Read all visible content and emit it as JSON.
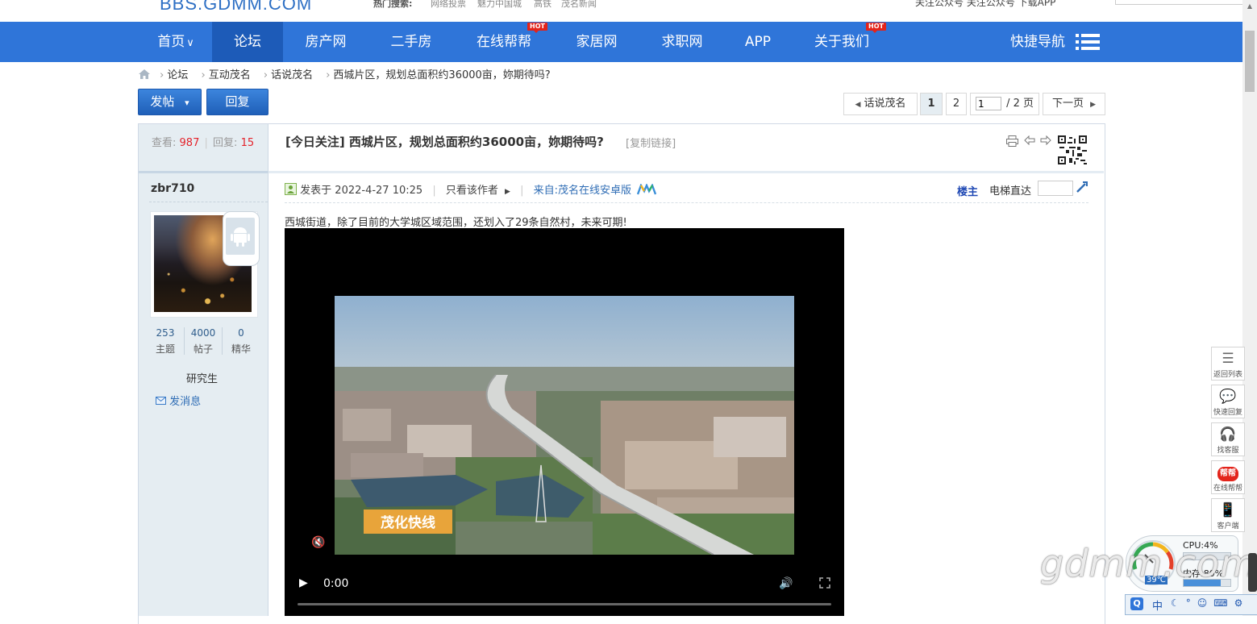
{
  "topbar": {
    "site_logo": "BBS.GDMM.COM",
    "hot_search_label": "热门搜索:",
    "hot_links": [
      "网络投票",
      "魅力中国城",
      "高铁",
      "茂名新闻"
    ],
    "right_text": "关注公众号  关注公众号  下载APP"
  },
  "nav": {
    "items": [
      {
        "label": "首页",
        "has_caret": true
      },
      {
        "label": "论坛",
        "active": true
      },
      {
        "label": "房产网"
      },
      {
        "label": "二手房"
      },
      {
        "label": "在线帮帮",
        "badge": "HOT"
      },
      {
        "label": "家居网"
      },
      {
        "label": "求职网"
      },
      {
        "label": "APP"
      },
      {
        "label": "关于我们",
        "badge": "HOT"
      }
    ],
    "quick_nav_label": "快捷导航",
    "home_caret": "∨"
  },
  "breadcrumb": [
    "论坛",
    "互动茂名",
    "话说茂名",
    "西城片区，规划总面积约36000亩，妳期待吗?"
  ],
  "actions": {
    "post_label": "发帖",
    "post_caret": "▾",
    "reply_label": "回复"
  },
  "pagination": {
    "back_label": "话说茂名",
    "pages": [
      "1",
      "2"
    ],
    "current_page_value": "1",
    "total_label": "/ 2 页",
    "next_label": "下一页"
  },
  "thread": {
    "views_label": "查看:",
    "views": "987",
    "divider": "|",
    "replies_label": "回复:",
    "replies": "15",
    "title": "[今日关注] 西城片区，规划总面积约36000亩，妳期待吗?",
    "copy_link_label": "[复制链接]"
  },
  "author": {
    "name": "zbr710",
    "stats": [
      {
        "value": "253",
        "label": "主题"
      },
      {
        "value": "4000",
        "label": "帖子"
      },
      {
        "value": "0",
        "label": "精华"
      }
    ],
    "rank": "研究生",
    "message_label": "发消息"
  },
  "post": {
    "posted_prefix": "发表于",
    "posted_time": "2022-4-27 10:25",
    "only_author_label": "只看该作者",
    "source_label": "来自:茂名在线安卓版",
    "floor_label": "楼主",
    "elevator_label": "电梯直达",
    "content": "西城街道，除了目前的大学城区域范围，还划入了29条自然村，未来可期!"
  },
  "video": {
    "caption": "茂化快线",
    "time": "0:00",
    "progress": 0
  },
  "float_tools": [
    {
      "icon": "list-icon",
      "label": "返回列表"
    },
    {
      "icon": "chat-icon",
      "label": "快速回复"
    },
    {
      "icon": "headset-icon",
      "label": "找客服"
    },
    {
      "icon": "bangbang-icon",
      "label": "在线帮帮",
      "glyph": "帮帮"
    },
    {
      "icon": "app-icon",
      "label": "客户端"
    }
  ],
  "watermark": "gdmm.com",
  "system_widget": {
    "cpu": "CPU:4%",
    "memory": "内存:80%",
    "temperature": "39℃"
  },
  "ime": {
    "text": "中"
  },
  "colors": {
    "nav_bg": "#2f75d9",
    "nav_active": "#1d5bb8",
    "sidebar_bg": "#e5edf2",
    "hot_badge": "#e3241b",
    "stat_red": "#e4232b"
  }
}
